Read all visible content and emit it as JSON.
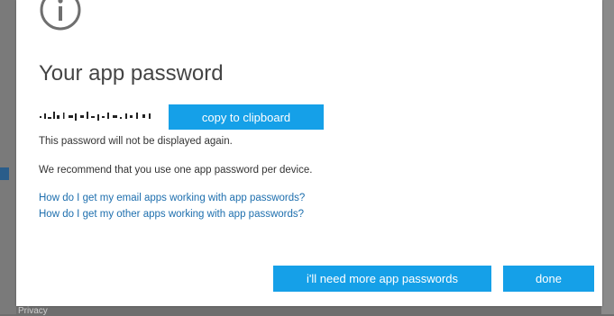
{
  "dialog": {
    "title": "Your app password",
    "icon": "info-icon",
    "copy_label": "copy to clipboard",
    "not_displayed_note": "This password will not be displayed again.",
    "recommend_note": "We recommend that you use one app password per device.",
    "links": [
      "How do I get my email apps working with app passwords?",
      "How do I get my other apps working with app passwords?"
    ],
    "more_passwords_label": "i'll need more app passwords",
    "done_label": "done"
  },
  "colors": {
    "accent": "#15a0e8",
    "link": "#1e6fae",
    "title": "#444444",
    "icon": "#6f6f6f"
  },
  "background": {
    "footer_text": "Privacy"
  }
}
